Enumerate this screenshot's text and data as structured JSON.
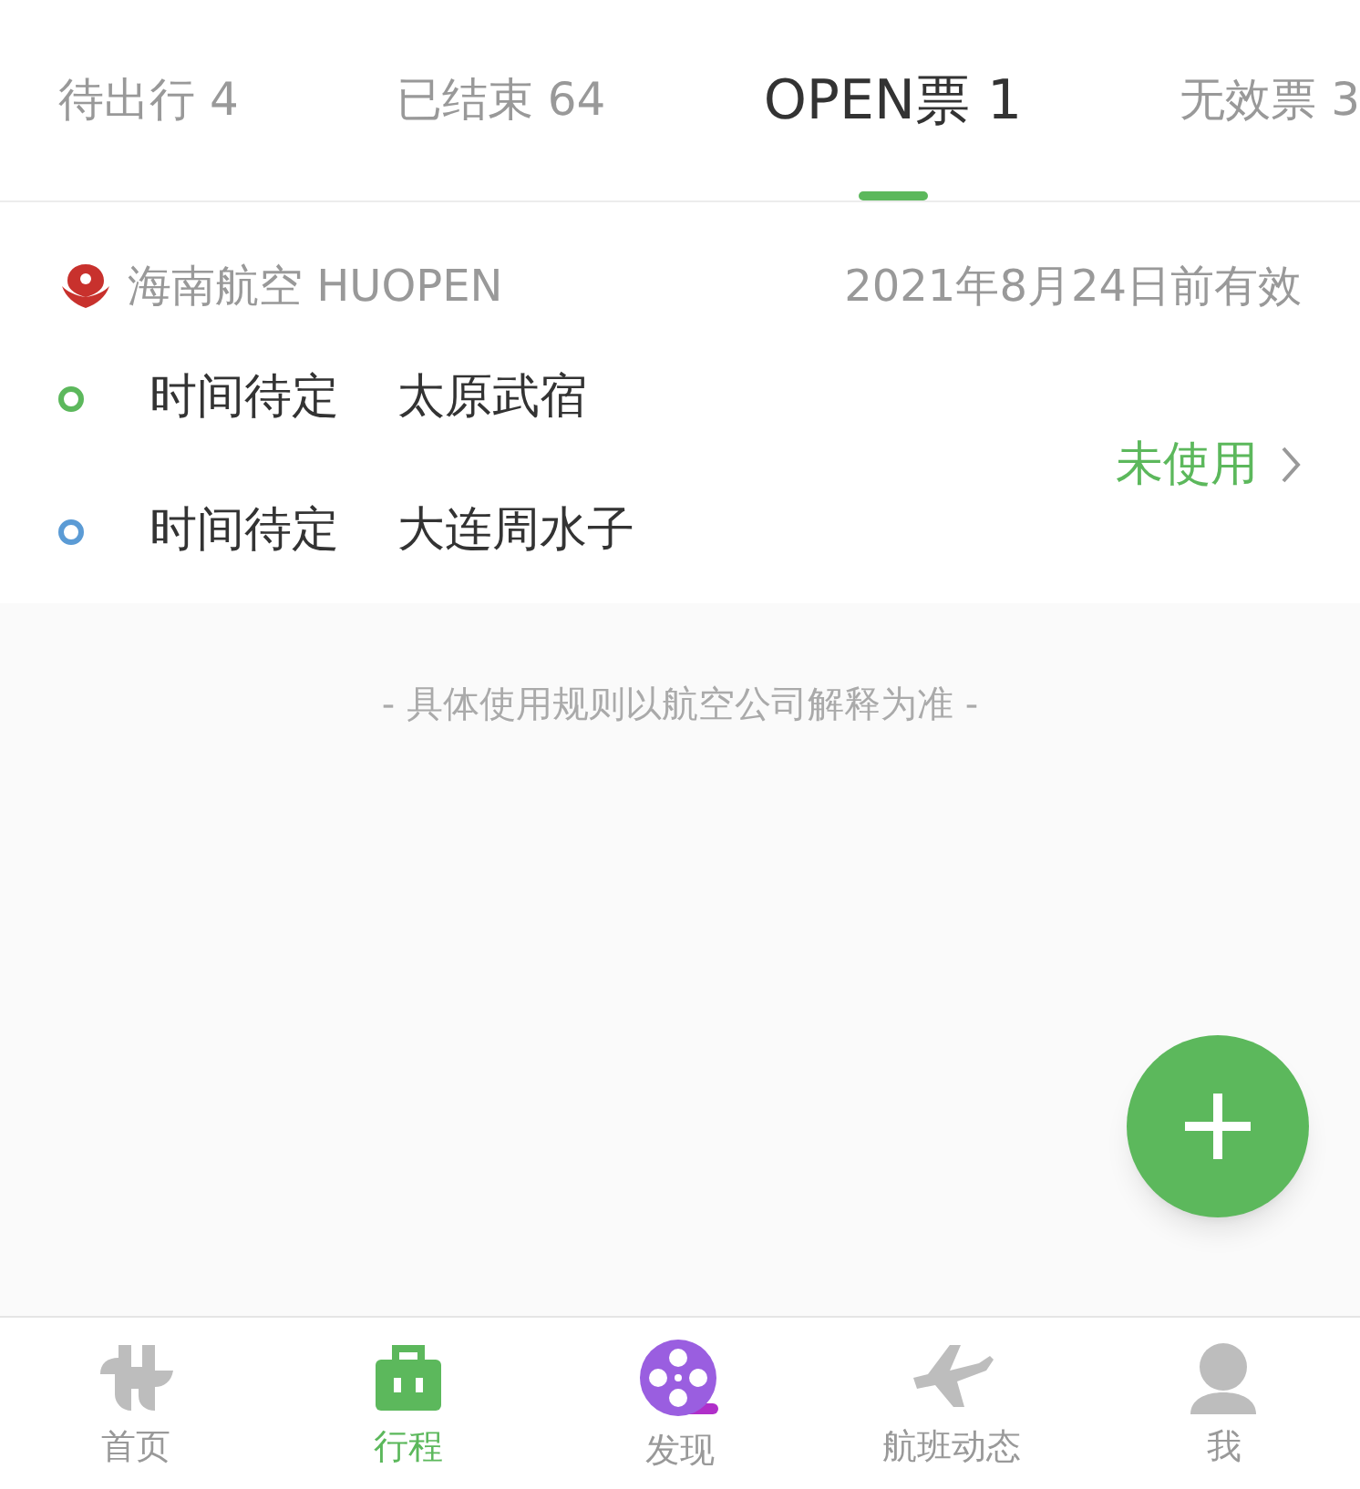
{
  "tabs": [
    {
      "label": "待出行 4",
      "selected": false
    },
    {
      "label": "已结束 64",
      "selected": false
    },
    {
      "label": "OPEN票 1",
      "selected": true
    },
    {
      "label": "无效票 3",
      "selected": false
    }
  ],
  "ticket": {
    "airline": "海南航空 HUOPEN",
    "validity": "2021年8月24日前有效",
    "segments": [
      {
        "time": "时间待定",
        "airport": "太原武宿",
        "color": "#5cb85c"
      },
      {
        "time": "时间待定",
        "airport": "大连周水子",
        "color": "#5b9bd5"
      }
    ],
    "status": "未使用"
  },
  "note": "- 具体使用规则以航空公司解释为准 -",
  "nav": [
    {
      "label": "首页",
      "kind": "home",
      "selected": false
    },
    {
      "label": "行程",
      "kind": "trips",
      "selected": true
    },
    {
      "label": "发现",
      "kind": "discover",
      "selected": false
    },
    {
      "label": "航班动态",
      "kind": "flights",
      "selected": false
    },
    {
      "label": "我",
      "kind": "me",
      "selected": false
    }
  ]
}
